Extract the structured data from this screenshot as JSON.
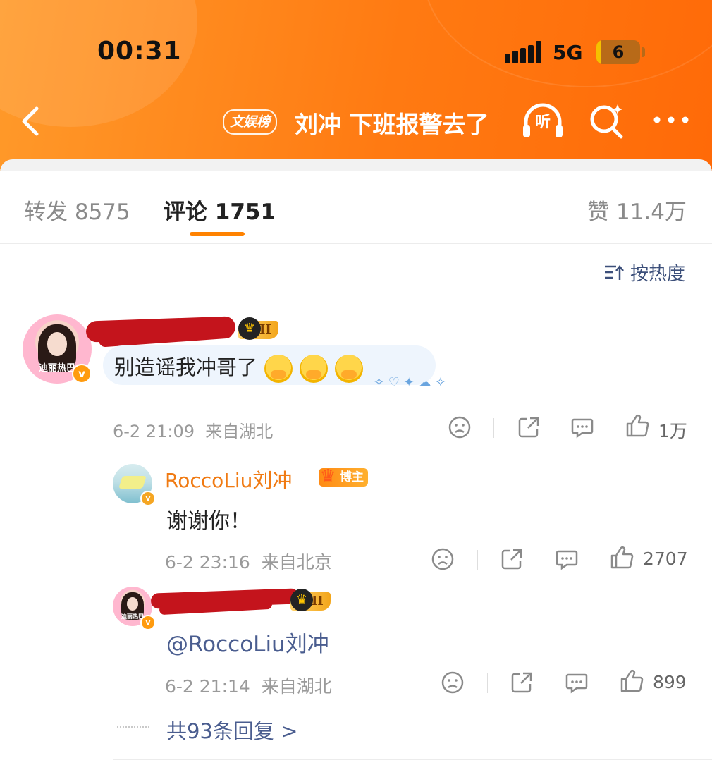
{
  "status_bar": {
    "time": "00:31",
    "network": "5G",
    "battery": "6",
    "battery_level_percent": 6
  },
  "nav": {
    "badge": "文娱榜",
    "title": "刘冲 下班报警去了",
    "listen_label": "听",
    "icons": [
      "back-chevron-icon",
      "headphones-icon",
      "search-icon",
      "more-icon"
    ]
  },
  "tabs": {
    "repost": "转发 8575",
    "comments": "评论 1751",
    "likes": "赞 11.4万"
  },
  "sort": {
    "label": "按热度"
  },
  "comment": {
    "text": "别造谣我冲哥了",
    "emoji": [
      "crying-emoji",
      "crying-emoji",
      "crying-emoji"
    ],
    "vip_level": "II",
    "avatar_text": "迪丽热巴",
    "date": "6-2 21:09",
    "location": "来自湖北",
    "like_count": "1万"
  },
  "replies": [
    {
      "name": "RoccoLiu刘冲",
      "badge": "博主",
      "text": "谢谢你！",
      "date": "6-2 23:16",
      "location": "来自北京",
      "like_count": "2707"
    },
    {
      "vip_level": "II",
      "avatar_text": "迪丽热巴",
      "mention": "@RoccoLiu刘冲",
      "date": "6-2 21:14",
      "location": "来自湖北",
      "like_count": "899"
    }
  ],
  "more_replies": "共93条回复 >",
  "colors": {
    "header": "#ff7a12",
    "accent": "#ff8200",
    "link": "#4a5d8f",
    "host_name": "#f07a12"
  }
}
